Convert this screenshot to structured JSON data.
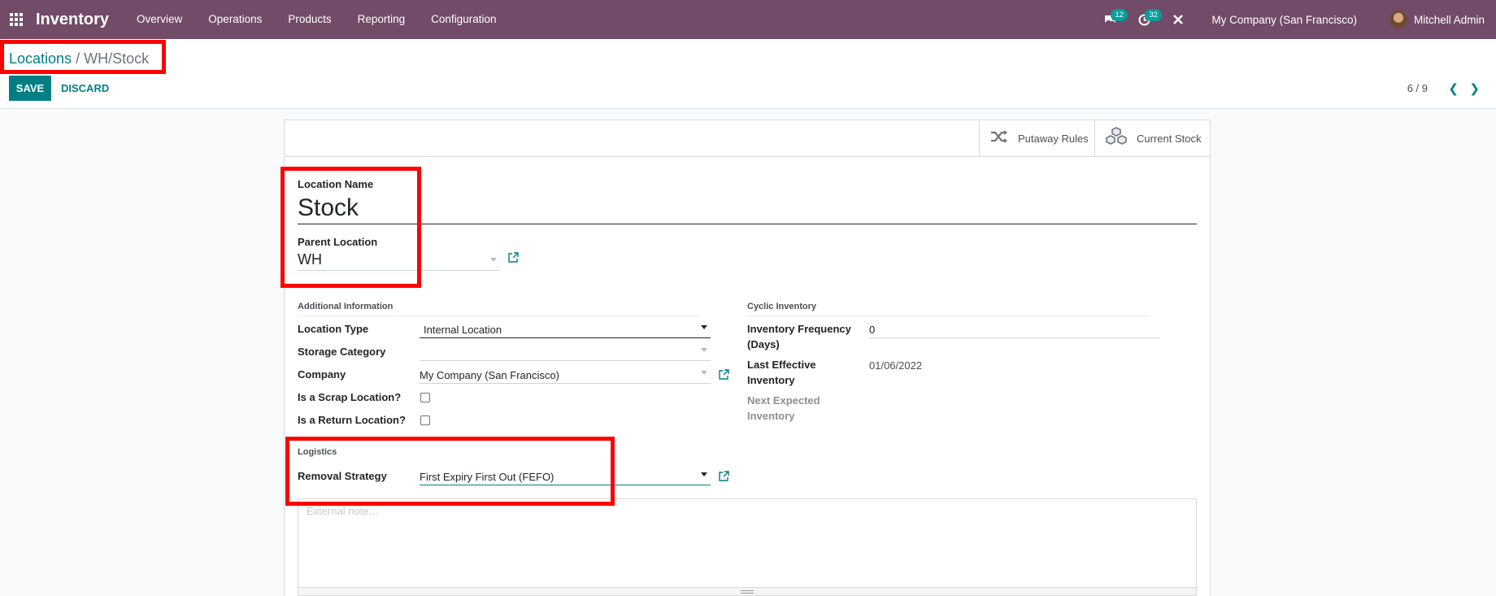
{
  "navbar": {
    "app_name": "Inventory",
    "menu": [
      "Overview",
      "Operations",
      "Products",
      "Reporting",
      "Configuration"
    ],
    "messages_count": "12",
    "activities_count": "32",
    "company": "My Company (San Francisco)",
    "user": "Mitchell Admin",
    "color": "#714b67"
  },
  "breadcrumb": {
    "parent": "Locations",
    "separator": "/",
    "current": "WH/Stock"
  },
  "toolbar": {
    "save_label": "SAVE",
    "discard_label": "DISCARD"
  },
  "pager": {
    "value": "6 / 9"
  },
  "smart_buttons": {
    "putaway": "Putaway Rules",
    "current_stock": "Current Stock"
  },
  "form": {
    "location_name_label": "Location Name",
    "location_name": "Stock",
    "parent_location_label": "Parent Location",
    "parent_location": "WH",
    "additional_info_title": "Additional Information",
    "location_type_label": "Location Type",
    "location_type": "Internal Location",
    "storage_category_label": "Storage Category",
    "storage_category": "",
    "company_label": "Company",
    "company": "My Company (San Francisco)",
    "scrap_label": "Is a Scrap Location?",
    "return_label": "Is a Return Location?",
    "cyclic_title": "Cyclic Inventory",
    "inv_freq_label_1": "Inventory Frequency",
    "inv_freq_label_2": "(Days)",
    "inv_freq": "0",
    "last_eff_label_1": "Last Effective",
    "last_eff_label_2": "Inventory",
    "last_eff": "01/06/2022",
    "next_exp_label_1": "Next Expected",
    "next_exp_label_2": "Inventory",
    "logistics_title": "Logistics",
    "removal_label": "Removal Strategy",
    "removal": "First Expiry First Out (FEFO)",
    "note_placeholder": "External note..."
  },
  "colors": {
    "accent": "#017e84",
    "highlight": "#ff0000"
  }
}
